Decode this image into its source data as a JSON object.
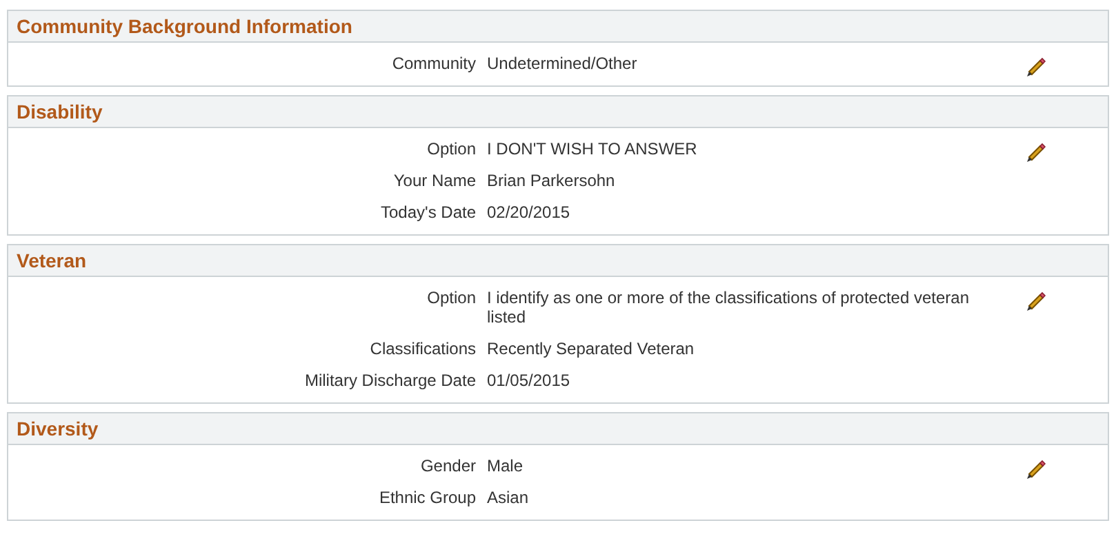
{
  "sections": [
    {
      "title": "Community Background Information",
      "fields": [
        {
          "label": "Community",
          "value": "Undetermined/Other"
        }
      ]
    },
    {
      "title": "Disability",
      "fields": [
        {
          "label": "Option",
          "value": "I DON'T WISH TO ANSWER"
        },
        {
          "label": "Your Name",
          "value": "Brian Parkersohn"
        },
        {
          "label": "Today's Date",
          "value": "02/20/2015"
        }
      ]
    },
    {
      "title": "Veteran",
      "fields": [
        {
          "label": "Option",
          "value": "I identify as one or more of the classifications of protected veteran listed"
        },
        {
          "label": "Classifications",
          "value": "Recently Separated Veteran"
        },
        {
          "label": "Military Discharge Date",
          "value": "01/05/2015"
        }
      ]
    },
    {
      "title": "Diversity",
      "fields": [
        {
          "label": "Gender",
          "value": "Male"
        },
        {
          "label": "Ethnic Group",
          "value": "Asian"
        }
      ]
    }
  ]
}
